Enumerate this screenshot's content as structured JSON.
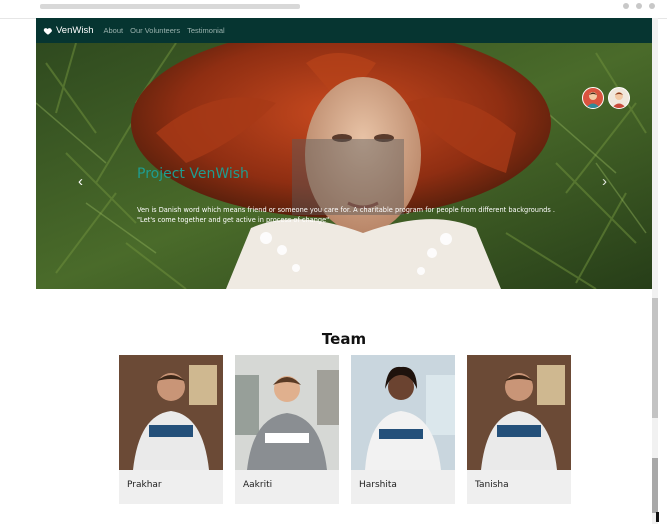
{
  "navbar": {
    "brand": "VenWish",
    "links": [
      "About",
      "Our Volunteers",
      "Testimonial"
    ]
  },
  "hero": {
    "title": "Project VenWish",
    "description_line1": "Ven is Danish word which means friend or someone you care for. A charitable program for people from different backgrounds .",
    "description_line2": "\"Let's come together and get active in process of change\"",
    "prev_arrow": "‹",
    "next_arrow": "›"
  },
  "team": {
    "title": "Team",
    "members": [
      {
        "name": "Prakhar"
      },
      {
        "name": "Aakriti"
      },
      {
        "name": "Harshita"
      },
      {
        "name": "Tanisha"
      }
    ]
  },
  "colors": {
    "navbar_bg": "#063531",
    "hero_title": "#1f9c8f",
    "card_bg": "#efefef"
  },
  "icons": [
    "heart-icon",
    "chevron-left-icon",
    "chevron-right-icon",
    "avatar-icon"
  ]
}
